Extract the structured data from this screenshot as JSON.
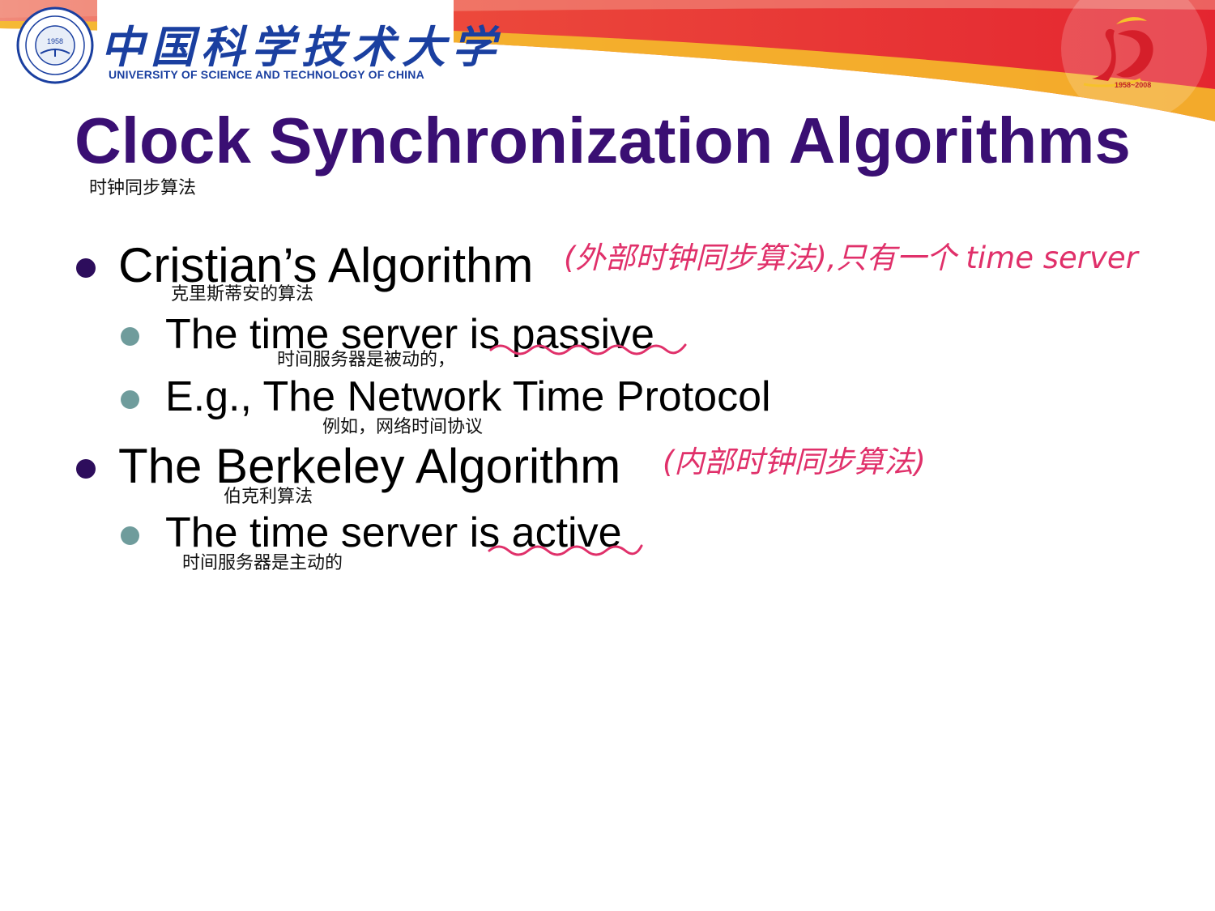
{
  "header": {
    "university_cn": "中国科学技术大学",
    "university_en": "UNIVERSITY OF SCIENCE AND TECHNOLOGY OF CHINA",
    "seal_year": "1958",
    "seal_text": "University of Science and Technology of China",
    "anniversary_years": "1958~2008",
    "colors": {
      "brand_blue": "#1a3fa0",
      "banner_red": "#e52a2f",
      "banner_yellow": "#f6c22a"
    }
  },
  "slide": {
    "title": "Clock Synchronization Algorithms",
    "title_note": "时钟同步算法",
    "title_color": "#3a0f73",
    "bullets": [
      {
        "text": "Cristian’s Algorithm",
        "note": "克里斯蒂安的算法",
        "handwritten": "(外部时钟同步算法),只有一个 time server",
        "sub": [
          {
            "text": "The time server is passive",
            "note": "时间服务器是被动的，"
          },
          {
            "text": "E.g., The Network Time Protocol",
            "note": "例如，网络时间协议"
          }
        ]
      },
      {
        "text": "The Berkeley Algorithm",
        "note": "伯克利算法",
        "handwritten": "(内部时钟同步算法)",
        "sub": [
          {
            "text": "The time server is active",
            "note": "时间服务器是主动的"
          }
        ]
      }
    ],
    "annotation_color": "#e0306a"
  }
}
